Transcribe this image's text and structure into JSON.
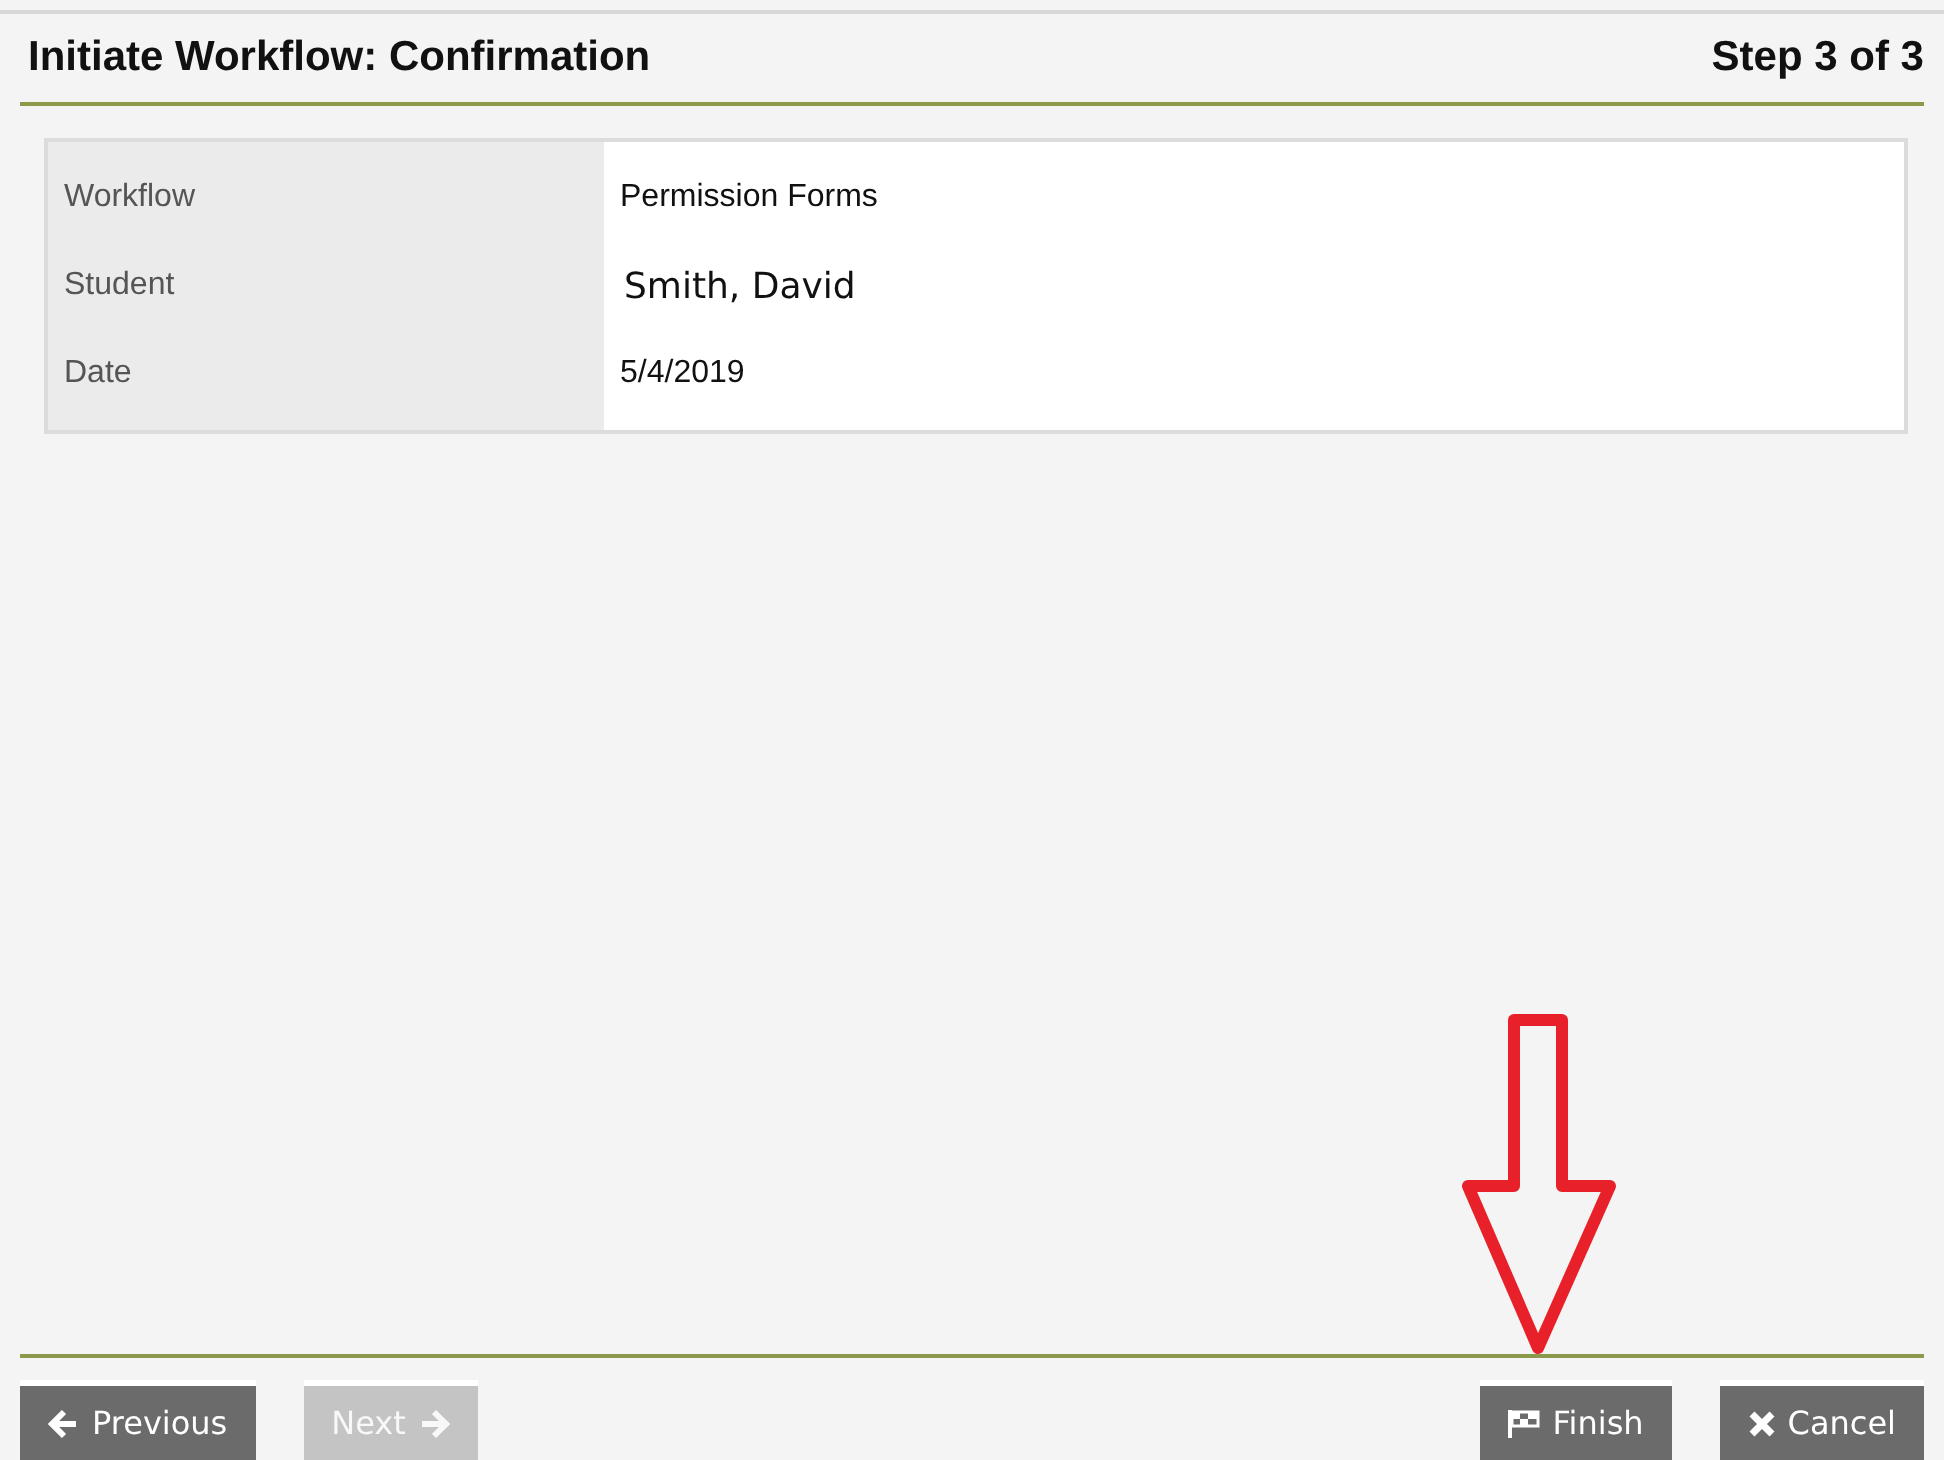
{
  "header": {
    "title": "Initiate Workflow: Confirmation",
    "step": "Step 3 of 3"
  },
  "details": [
    {
      "label": "Workflow",
      "value": "Permission Forms",
      "pasted": false
    },
    {
      "label": "Student",
      "value": "Smith, David",
      "pasted": true
    },
    {
      "label": "Date",
      "value": "5/4/2019",
      "pasted": false
    }
  ],
  "buttons": [
    {
      "kind": "previous",
      "label": "Previous",
      "disabled": false
    },
    {
      "kind": "next",
      "label": "Next",
      "disabled": true
    },
    {
      "kind": "finish",
      "label": "Finish",
      "disabled": false
    },
    {
      "kind": "cancel",
      "label": "Cancel",
      "disabled": false
    }
  ]
}
